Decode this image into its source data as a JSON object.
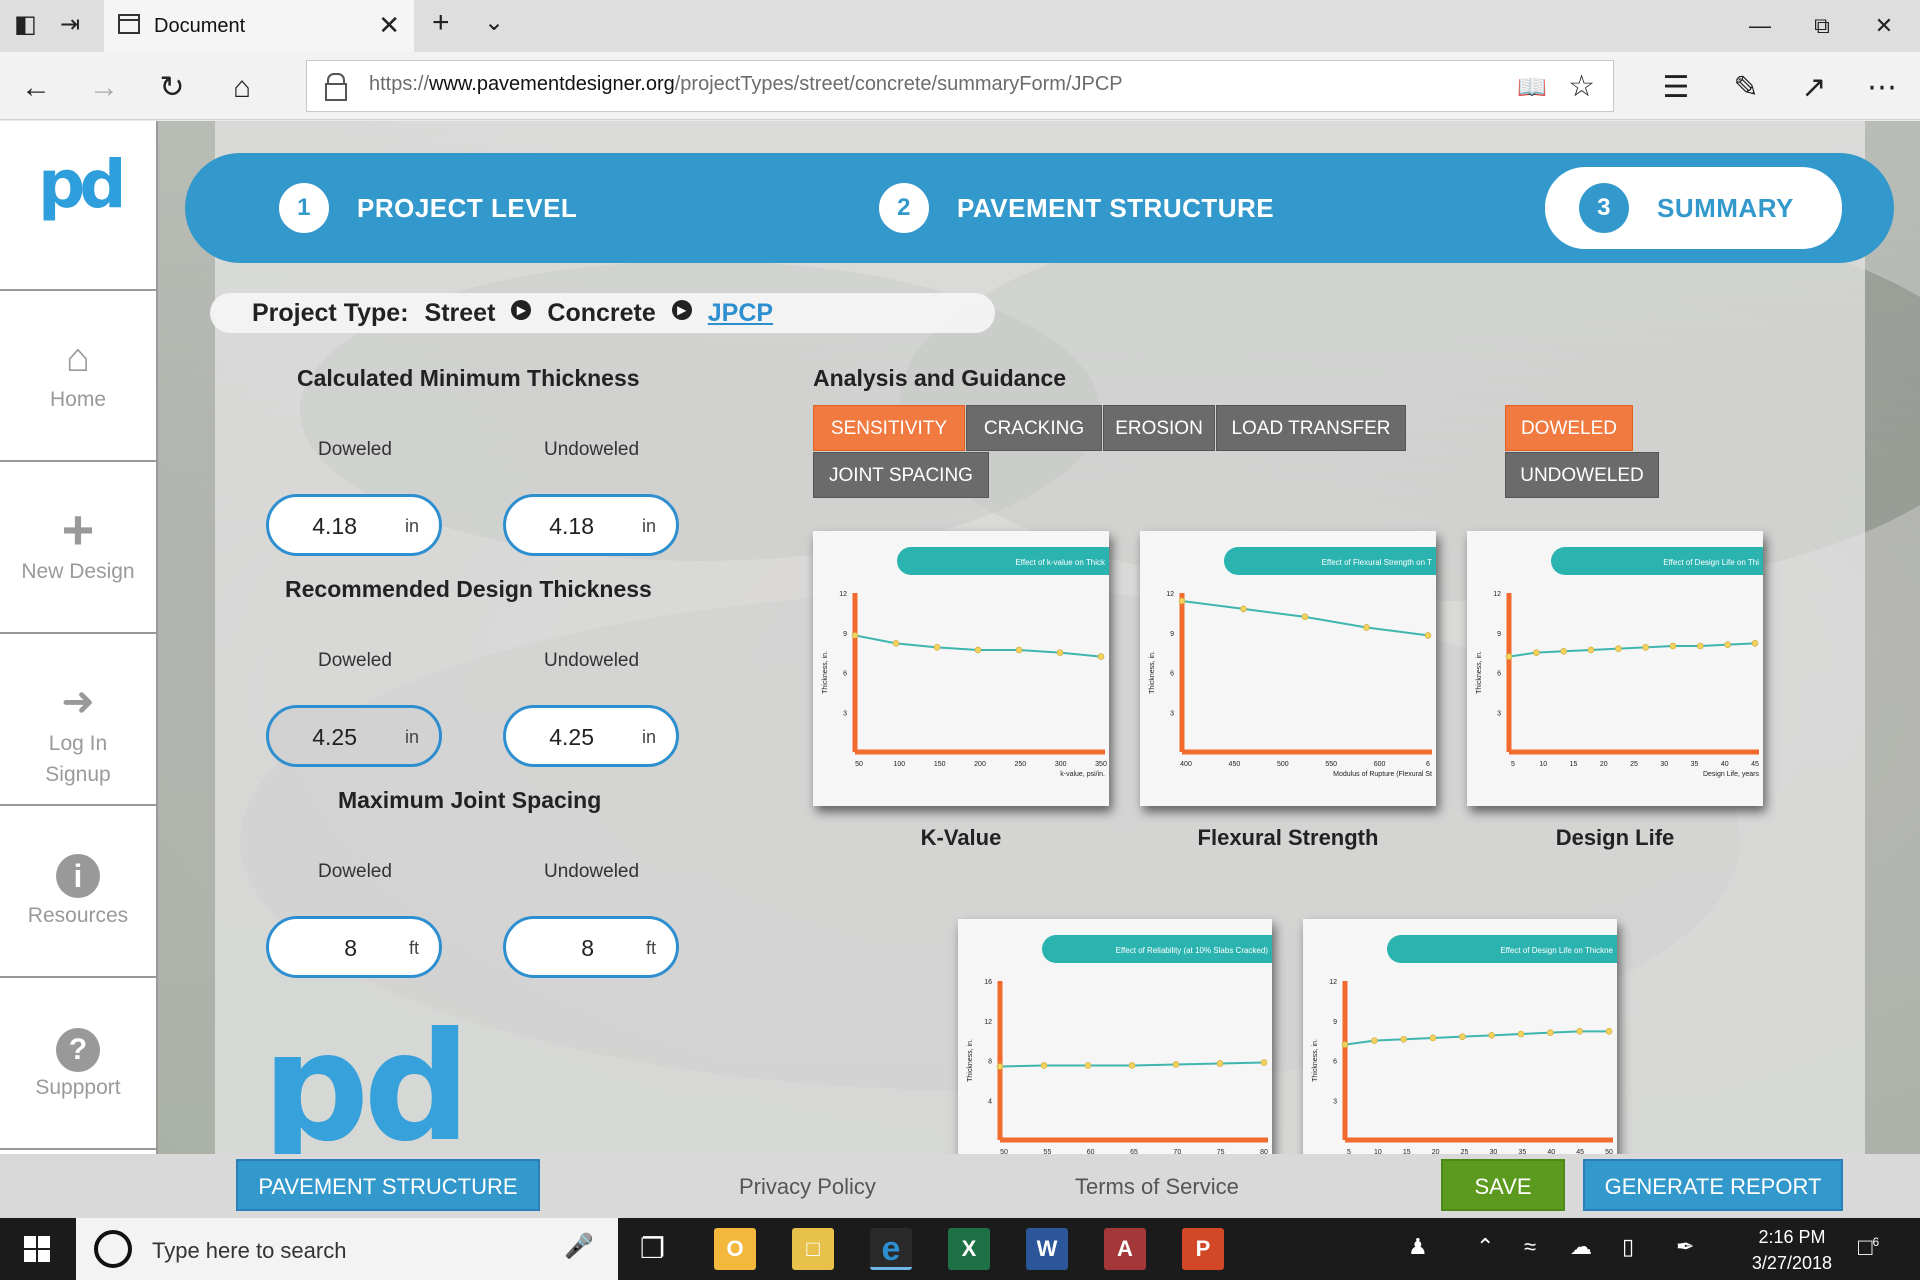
{
  "browser": {
    "tab_title": "Document",
    "url_prefix": "https://",
    "url_host": "www.pavementdesigner.org",
    "url_path": "/projectTypes/street/concrete/summaryForm/JPCP"
  },
  "sidebar": {
    "items": [
      {
        "label": "Home"
      },
      {
        "label": "New Design"
      },
      {
        "label": "Log In"
      },
      {
        "label": "Signup"
      },
      {
        "label": "Resources"
      },
      {
        "label": "Suppport"
      }
    ]
  },
  "stepper": {
    "steps": [
      {
        "num": "1",
        "label": "PROJECT LEVEL"
      },
      {
        "num": "2",
        "label": "PAVEMENT STRUCTURE"
      },
      {
        "num": "3",
        "label": "SUMMARY"
      }
    ]
  },
  "breadcrumb": {
    "prefix": "Project Type:",
    "level1": "Street",
    "level2": "Concrete",
    "level3": "JPCP"
  },
  "thickness": {
    "calc_title": "Calculated Minimum Thickness",
    "rec_title": "Recommended Design Thickness",
    "joint_title": "Maximum Joint Spacing",
    "doweled": "Doweled",
    "undoweled": "Undoweled",
    "calc_doweled": "4.18",
    "calc_undoweled": "4.18",
    "rec_doweled": "4.25",
    "rec_undoweled": "4.25",
    "joint_doweled": "8",
    "joint_undoweled": "8",
    "unit_in": "in",
    "unit_ft": "ft"
  },
  "analysis": {
    "title": "Analysis and Guidance",
    "tabs": [
      "SENSITIVITY",
      "CRACKING",
      "EROSION",
      "LOAD TRANSFER",
      "JOINT SPACING"
    ],
    "active_tab": "SENSITIVITY",
    "dowel_options": [
      "DOWELED",
      "UNDOWELED"
    ],
    "active_dowel": "DOWELED",
    "charts": [
      {
        "caption": "K-Value",
        "banner": "Effect of k-value on Thick",
        "ylabel": "Thickness, in.",
        "xlabel": "k-value, psi/in.",
        "yticks": [
          "12",
          "9",
          "6",
          "3"
        ],
        "xticks": [
          "50",
          "100",
          "150",
          "200",
          "250",
          "300",
          "350"
        ],
        "x": [
          50,
          100,
          150,
          200,
          250,
          300,
          350
        ],
        "values": [
          8.8,
          8.2,
          7.9,
          7.7,
          7.7,
          7.5,
          7.2
        ]
      },
      {
        "caption": "Flexural Strength",
        "banner": "Effect of Flexural Strength on T",
        "ylabel": "Thickness, in.",
        "xlabel": "Modulus of Rupture (Flexural St",
        "yticks": [
          "12",
          "9",
          "6",
          "3"
        ],
        "xticks": [
          "400",
          "450",
          "500",
          "550",
          "600",
          "6"
        ],
        "x": [
          400,
          450,
          500,
          550,
          600
        ],
        "values": [
          11.4,
          10.8,
          10.2,
          9.4,
          8.8
        ]
      },
      {
        "caption": "Design Life",
        "banner": "Effect of Design Life on Thi",
        "ylabel": "Thickness, in.",
        "xlabel": "Design Life, years",
        "yticks": [
          "12",
          "9",
          "6",
          "3"
        ],
        "xticks": [
          "5",
          "10",
          "15",
          "20",
          "25",
          "30",
          "35",
          "40",
          "45"
        ],
        "x": [
          5,
          10,
          15,
          20,
          25,
          30,
          35,
          40,
          45,
          50
        ],
        "values": [
          7.2,
          7.5,
          7.6,
          7.7,
          7.8,
          7.9,
          8.0,
          8.0,
          8.1,
          8.2
        ]
      },
      {
        "caption": "",
        "banner": "Effect of Reliability (at 10% Slabs Cracked)",
        "ylabel": "Thickness, in.",
        "xlabel": "",
        "yticks": [
          "16",
          "12",
          "8",
          "4"
        ],
        "xticks": [
          "50",
          "55",
          "60",
          "65",
          "70",
          "75",
          "80"
        ],
        "x": [
          50,
          55,
          60,
          65,
          70,
          75,
          80
        ],
        "values": [
          7.4,
          7.5,
          7.5,
          7.5,
          7.6,
          7.7,
          7.8
        ]
      },
      {
        "caption": "",
        "banner": "Effect of Design Life on Thickne",
        "ylabel": "Thickness, in.",
        "xlabel": "",
        "yticks": [
          "12",
          "9",
          "6",
          "3"
        ],
        "xticks": [
          "5",
          "10",
          "15",
          "20",
          "25",
          "30",
          "35",
          "40",
          "45",
          "50"
        ],
        "x": [
          5,
          10,
          15,
          20,
          25,
          30,
          35,
          40,
          45,
          50
        ],
        "values": [
          7.2,
          7.5,
          7.6,
          7.7,
          7.8,
          7.9,
          8.0,
          8.1,
          8.2,
          8.2
        ]
      }
    ]
  },
  "footer": {
    "back_label": "PAVEMENT STRUCTURE",
    "privacy": "Privacy Policy",
    "terms": "Terms of Service",
    "save_label": "SAVE",
    "report_label": "GENERATE REPORT"
  },
  "taskbar": {
    "search_placeholder": "Type here to search",
    "time": "2:16 PM",
    "date": "3/27/2018",
    "notification_count": "6"
  },
  "colors": {
    "brand_blue": "#3399cc",
    "accent_orange": "#f07a3f",
    "save_green": "#5b9a1f",
    "chart_line": "#3fb5b0",
    "chart_axis": "#f26b2e",
    "chart_marker": "#f2d25c"
  }
}
